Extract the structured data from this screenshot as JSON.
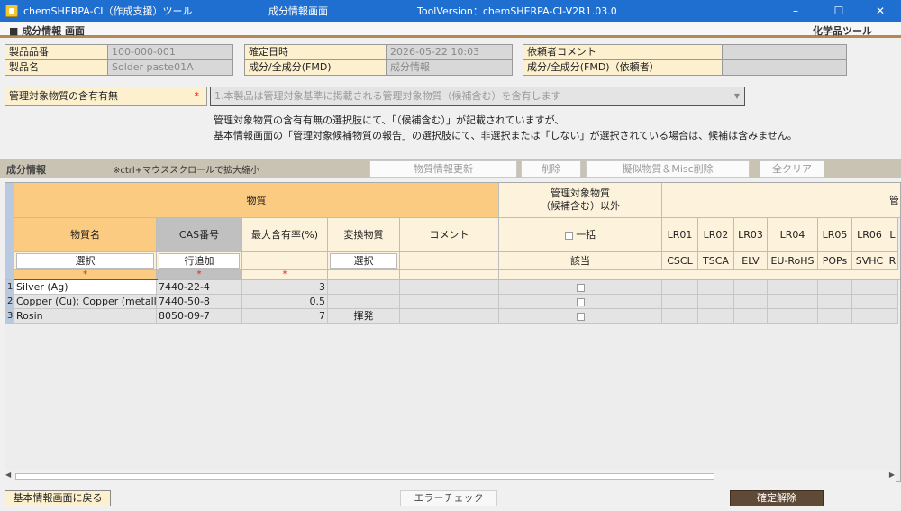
{
  "window": {
    "app_title": "chemSHERPA-CI（作成支援）ツール",
    "screen_title": "成分情報画面",
    "version": "ToolVersion：chemSHERPA-CI-V2R1.03.0"
  },
  "header": {
    "left": "■ 成分情報 画面",
    "right": "化学品ツール"
  },
  "info": {
    "product_no_label": "製品品番",
    "product_no": "100-000-001",
    "product_name_label": "製品名",
    "product_name": "Solder paste01A",
    "confirm_label": "確定日時",
    "confirm_value": "2026-05-22 10:03",
    "fmd_label": "成分/全成分(FMD)",
    "fmd_value": "成分情報",
    "req_comment_label": "依頼者コメント",
    "req_comment_value": "",
    "fmd_req_label": "成分/全成分(FMD)（依頼者）",
    "fmd_req_value": ""
  },
  "managed": {
    "label": "管理対象物質の含有有無",
    "required": "*",
    "selected": "1.本製品は管理対象基準に掲載される管理対象物質（候補含む）を含有します",
    "note1": "管理対象物質の含有有無の選択肢にて、「（候補含む）」が記載されていますが、",
    "note2": "基本情報画面の「管理対象候補物質の報告」の選択肢にて、非選択または「しない」が選択されている場合は、候補は含みません。"
  },
  "section": {
    "name": "成分情報",
    "hint": "※ctrl+マウススクロールで拡大縮小",
    "btn_update": "物質情報更新",
    "btn_delete": "削除",
    "btn_pseudo_delete": "擬似物質＆Misc削除",
    "btn_clear": "全クリア"
  },
  "grid": {
    "group_substance": "物質",
    "group_managed_1": "管理対象物質",
    "group_managed_2": "（候補含む）以外",
    "group_right": "管",
    "col_name": "物質名",
    "col_cas": "CAS番号",
    "col_max": "最大含有率(%)",
    "col_conv": "変換物質",
    "col_comment": "コメント",
    "col_bulk": "一括",
    "btn_select": "選択",
    "btn_addrow": "行追加",
    "btn_select2": "選択",
    "applicable": "該当",
    "required": "*",
    "lr": [
      {
        "code": "LR01",
        "name": "CSCL"
      },
      {
        "code": "LR02",
        "name": "TSCA"
      },
      {
        "code": "LR03",
        "name": "ELV"
      },
      {
        "code": "LR04",
        "name": "EU-RoHS"
      },
      {
        "code": "LR05",
        "name": "POPs"
      },
      {
        "code": "LR06",
        "name": "SVHC"
      },
      {
        "code": "L",
        "name": "R"
      }
    ],
    "rows": [
      {
        "no": "1",
        "name": "Silver (Ag)",
        "cas": "7440-22-4",
        "max": "3",
        "conv": ""
      },
      {
        "no": "2",
        "name": "Copper (Cu); Copper (metall…",
        "cas": "7440-50-8",
        "max": "0.5",
        "conv": ""
      },
      {
        "no": "3",
        "name": "Rosin",
        "cas": "8050-09-7",
        "max": "7",
        "conv": "揮発"
      }
    ]
  },
  "footer": {
    "back": "基本情報画面に戻る",
    "error_check": "エラーチェック",
    "unconfirm": "確定解除"
  }
}
